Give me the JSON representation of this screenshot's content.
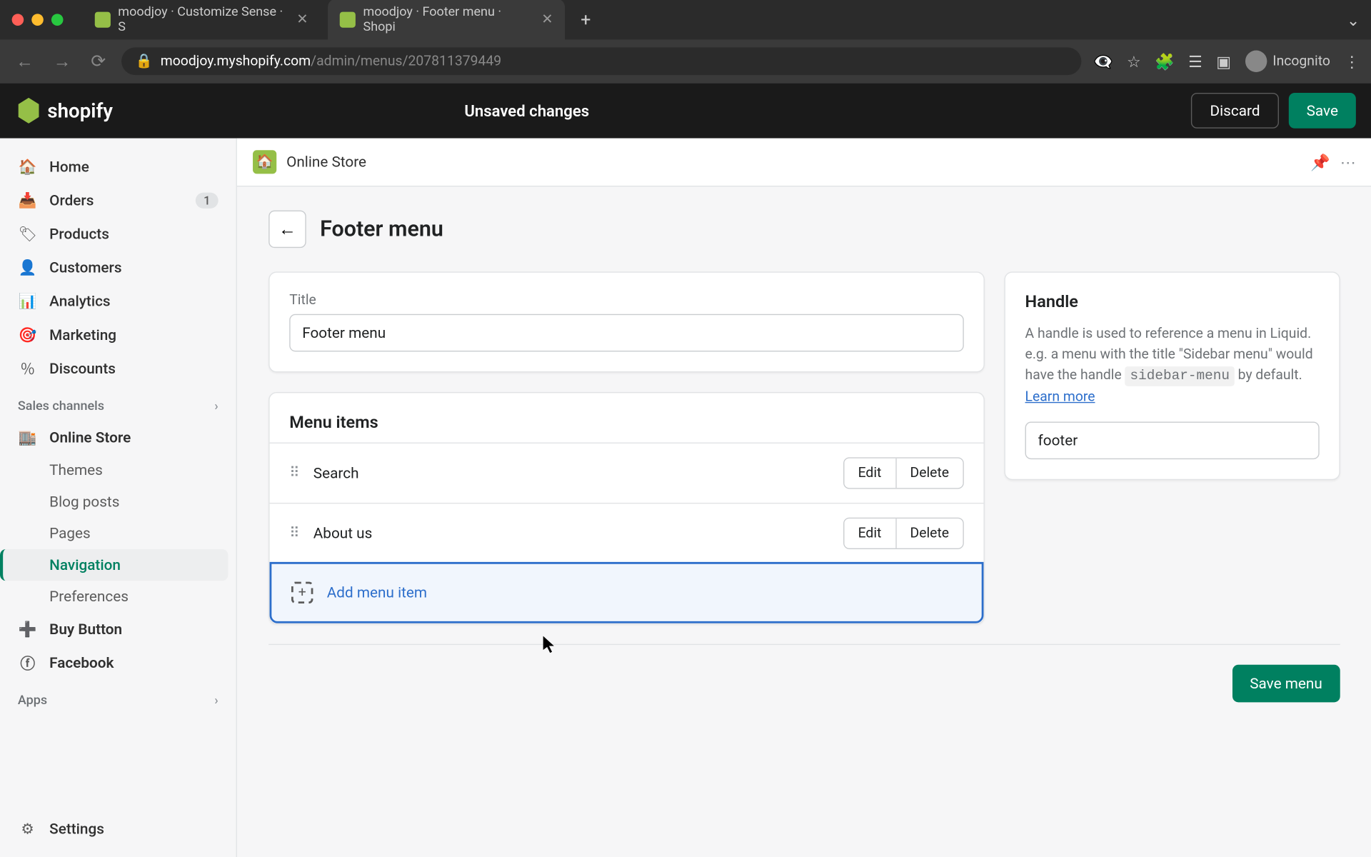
{
  "browser": {
    "tabs": [
      {
        "title": "moodjoy · Customize Sense · S",
        "active": false
      },
      {
        "title": "moodjoy · Footer menu · Shopi",
        "active": true
      }
    ],
    "url_prefix": "moodjoy.myshopify.com",
    "url_path": "/admin/menus/207811379449",
    "incognito_label": "Incognito"
  },
  "topbar": {
    "logo_text": "shopify",
    "unsaved_label": "Unsaved changes",
    "discard_label": "Discard",
    "save_label": "Save"
  },
  "sidebar": {
    "items": [
      {
        "label": "Home",
        "icon": "home"
      },
      {
        "label": "Orders",
        "icon": "orders",
        "badge": "1"
      },
      {
        "label": "Products",
        "icon": "products"
      },
      {
        "label": "Customers",
        "icon": "customers"
      },
      {
        "label": "Analytics",
        "icon": "analytics"
      },
      {
        "label": "Marketing",
        "icon": "marketing"
      },
      {
        "label": "Discounts",
        "icon": "discounts"
      }
    ],
    "sales_channels_label": "Sales channels",
    "online_store_label": "Online Store",
    "online_store_sub": [
      {
        "label": "Themes"
      },
      {
        "label": "Blog posts"
      },
      {
        "label": "Pages"
      },
      {
        "label": "Navigation",
        "active": true
      },
      {
        "label": "Preferences"
      }
    ],
    "buy_button_label": "Buy Button",
    "facebook_label": "Facebook",
    "apps_label": "Apps",
    "settings_label": "Settings"
  },
  "breadcrumb": {
    "label": "Online Store"
  },
  "page": {
    "title": "Footer menu",
    "title_field_label": "Title",
    "title_field_value": "Footer menu",
    "menu_items_heading": "Menu items",
    "menu_items": [
      {
        "label": "Search"
      },
      {
        "label": "About us"
      }
    ],
    "edit_label": "Edit",
    "delete_label": "Delete",
    "add_menu_item_label": "Add menu item",
    "save_menu_label": "Save menu"
  },
  "handle": {
    "heading": "Handle",
    "desc_1": "A handle is used to reference a menu in Liquid. e.g. a menu with the title \"Sidebar menu\" would have the handle ",
    "code": "sidebar-menu",
    "desc_2": " by default. ",
    "learn_more": "Learn more",
    "value": "footer"
  }
}
